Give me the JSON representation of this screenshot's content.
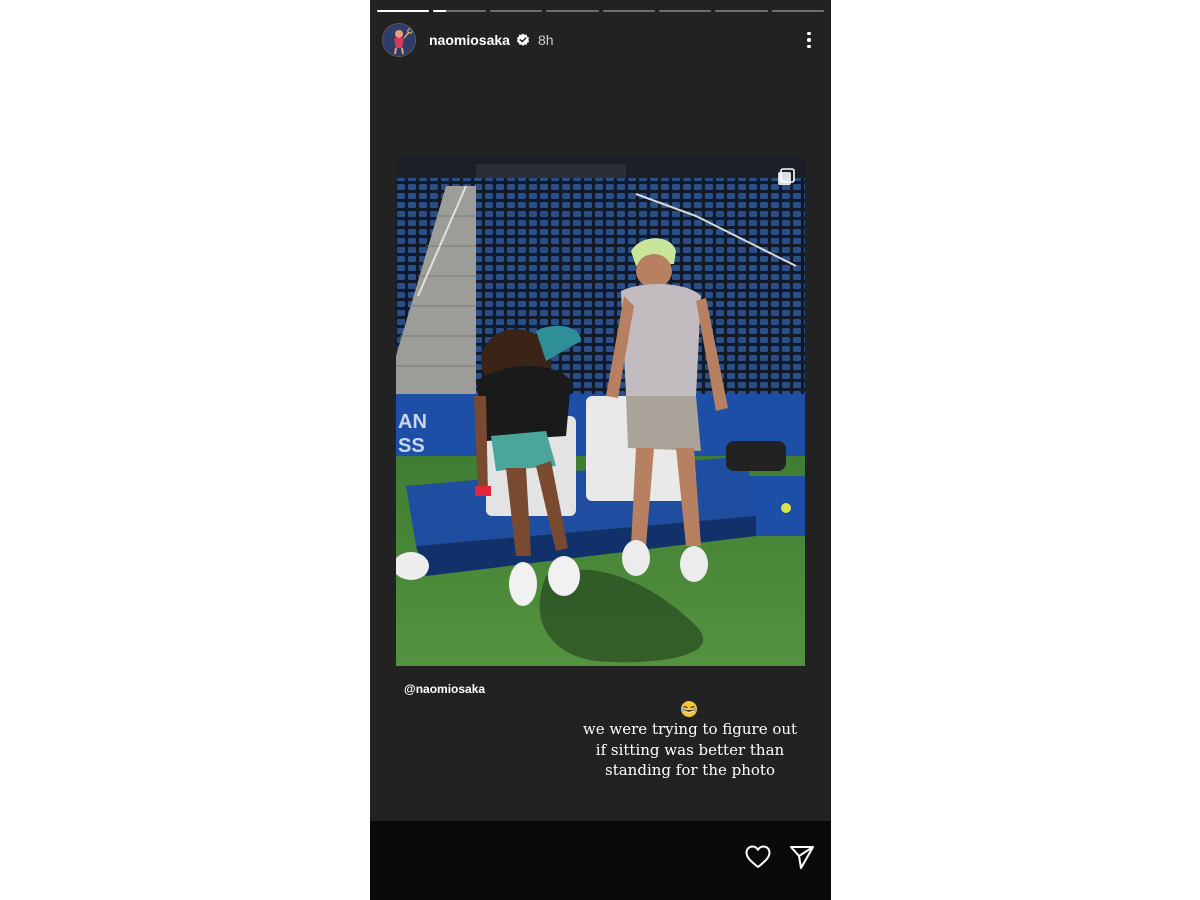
{
  "story": {
    "progress": [
      1,
      0.25,
      0,
      0,
      0,
      0,
      0,
      0
    ],
    "username": "naomiosaka",
    "time": "8h",
    "mention": "@naomiosaka",
    "caption_lines": [
      "we were trying to figure out",
      "if sitting was better than",
      "standing for the photo"
    ]
  },
  "icons": {
    "verified": "verified-badge-icon",
    "more": "more-options-icon",
    "multi_photo": "multiple-photos-icon",
    "emoji": "laughing-emoji-icon",
    "like": "heart-icon",
    "share": "send-icon"
  },
  "colors": {
    "story_bg": "#222222",
    "footer_bg": "#0a0a0a",
    "court_green": "#4e8a3a",
    "bench_blue": "#1d4fa6"
  }
}
